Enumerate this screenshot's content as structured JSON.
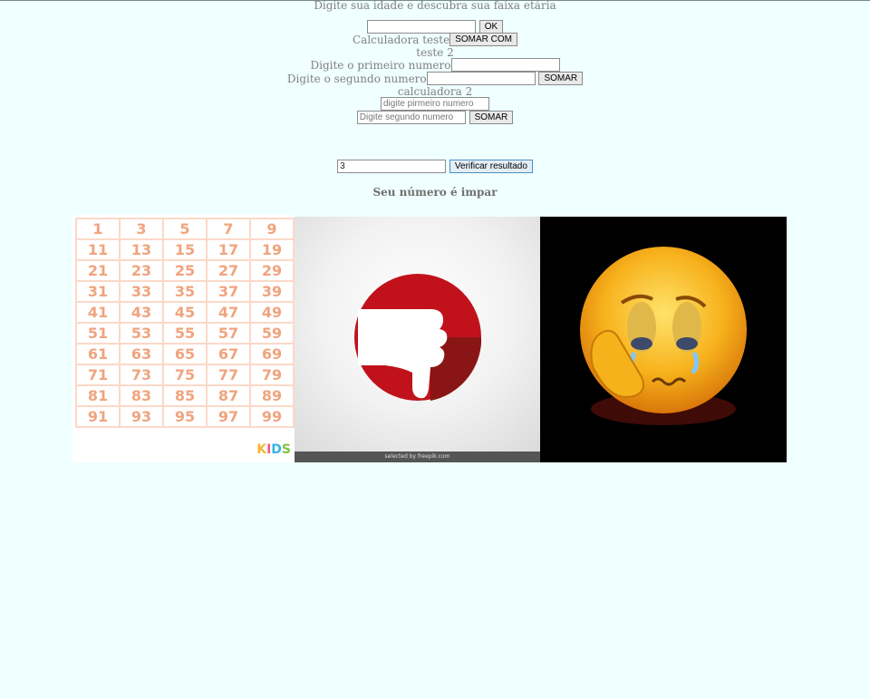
{
  "age_section": {
    "prompt": "Digite sua idade e descubra sua faixa etária",
    "ok_label": "OK"
  },
  "calc_teste": {
    "label": "Calculadora teste",
    "button_label": "SOMAR COM"
  },
  "teste2": {
    "title": "teste 2",
    "first_label": "Digite o primeiro numero",
    "second_label": "Digite o segundo numero",
    "button_label": "SOMAR"
  },
  "calc2": {
    "title": "calculadora 2",
    "first_placeholder": "digite pirmeiro numero",
    "second_placeholder": "Digite segundo numero",
    "button_label": "SOMAR"
  },
  "verify": {
    "input_value": "3",
    "button_label": "Verificar resultado",
    "result_text": "Seu número é impar"
  },
  "odd_numbers": [
    [
      "1",
      "3",
      "5",
      "7",
      "9"
    ],
    [
      "11",
      "13",
      "15",
      "17",
      "19"
    ],
    [
      "21",
      "23",
      "25",
      "27",
      "29"
    ],
    [
      "31",
      "33",
      "35",
      "37",
      "39"
    ],
    [
      "41",
      "43",
      "45",
      "47",
      "49"
    ],
    [
      "51",
      "53",
      "55",
      "57",
      "59"
    ],
    [
      "61",
      "63",
      "65",
      "67",
      "69"
    ],
    [
      "71",
      "73",
      "75",
      "77",
      "79"
    ],
    [
      "81",
      "83",
      "85",
      "87",
      "89"
    ],
    [
      "91",
      "93",
      "95",
      "97",
      "99"
    ]
  ],
  "images": {
    "grid_brand": "KIDS",
    "thumb_caption": "selected by freepik.com",
    "thumb_icon": "thumbs-down-icon",
    "emoji_icon": "crying-emoji"
  },
  "colors": {
    "background": "#f0ffff",
    "text": "#808080",
    "grid_number": "#f0a47e",
    "thumb_red": "#c1121c"
  }
}
